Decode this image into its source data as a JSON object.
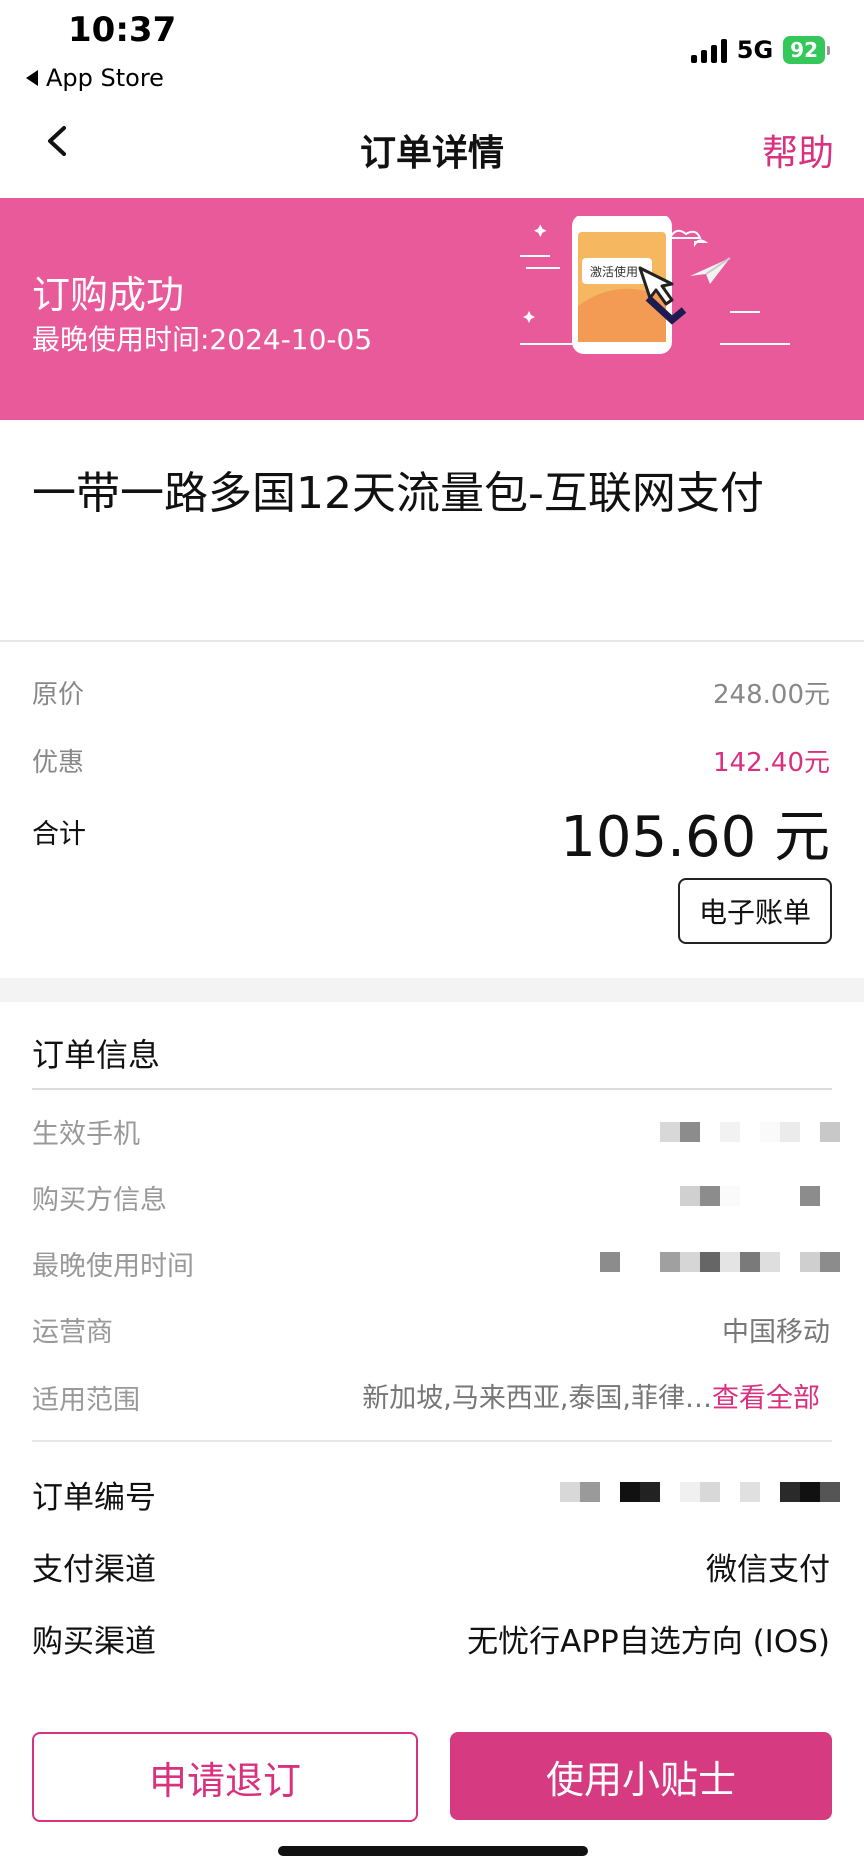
{
  "status_bar": {
    "time": "10:37",
    "back_app": "App Store",
    "network": "5G",
    "battery": "92"
  },
  "nav": {
    "title": "订单详情",
    "help": "帮助"
  },
  "banner": {
    "title": "订购成功",
    "subtitle": "最晚使用时间:2024-10-05",
    "illustration_text": "激活使用",
    "bg_color": "#e85a9a"
  },
  "product": {
    "title": "一带一路多国12天流量包-互联网支付"
  },
  "price": {
    "original_label": "原价",
    "original_value": "248.00元",
    "discount_label": "优惠",
    "discount_value": "142.40元",
    "total_label": "合计",
    "total_value": "105.60 元",
    "ebill_button": "电子账单"
  },
  "order_info": {
    "section_title": "订单信息",
    "rows": [
      {
        "label": "生效手机",
        "value": ""
      },
      {
        "label": "购买方信息",
        "value": ""
      },
      {
        "label": "最晚使用时间",
        "value": ""
      },
      {
        "label": "运营商",
        "value": "中国移动"
      },
      {
        "label": "适用范围",
        "value": "新加坡,马来西亚,泰国,菲律…",
        "link": "查看全部"
      }
    ],
    "details": [
      {
        "label": "订单编号",
        "value": ""
      },
      {
        "label": "支付渠道",
        "value": "微信支付"
      },
      {
        "label": "购买渠道",
        "value": "无忧行APP自选方向 (IOS)"
      }
    ]
  },
  "actions": {
    "refund": "申请退订",
    "tips": "使用小贴士"
  },
  "colors": {
    "accent": "#d9307f",
    "primary_button": "#d63b82"
  }
}
